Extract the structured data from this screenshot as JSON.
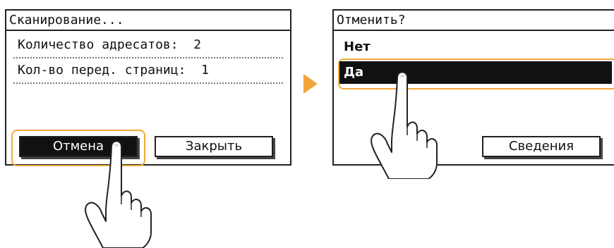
{
  "left_screen": {
    "title": "Сканирование...",
    "rows": [
      "Количество адресатов:  2",
      "Кол-во перед. страниц:  1"
    ],
    "cancel_button": "Отмена",
    "close_button": "Закрыть"
  },
  "right_screen": {
    "title": "Отменить?",
    "options": [
      "Нет",
      "Да"
    ],
    "selected_option": "Да",
    "details_button": "Сведения"
  },
  "colors": {
    "highlight": "#f2a93b",
    "arrow": "#f2a53b"
  },
  "icons": {
    "pointer": "hand-pointer-icon",
    "transition": "arrow-right-icon"
  }
}
